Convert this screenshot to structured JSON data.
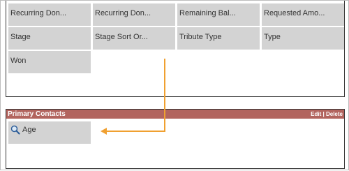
{
  "layout_fields": [
    {
      "label": "Recurring Don..."
    },
    {
      "label": "Recurring Don..."
    },
    {
      "label": "Remaining Bal..."
    },
    {
      "label": "Requested Amo..."
    },
    {
      "label": "Stage"
    },
    {
      "label": "Stage Sort Or..."
    },
    {
      "label": "Tribute Type"
    },
    {
      "label": "Type"
    },
    {
      "label": "Won"
    }
  ],
  "section": {
    "title": "Primary Contacts",
    "edit_label": "Edit",
    "separator": "|",
    "delete_label": "Delete"
  },
  "section_fields": [
    {
      "label": "Age",
      "icon": "magnifier-icon"
    }
  ],
  "colors": {
    "header_bg": "#b2645e",
    "field_bg": "#d3d3d3",
    "arrow": "#f0a030"
  }
}
